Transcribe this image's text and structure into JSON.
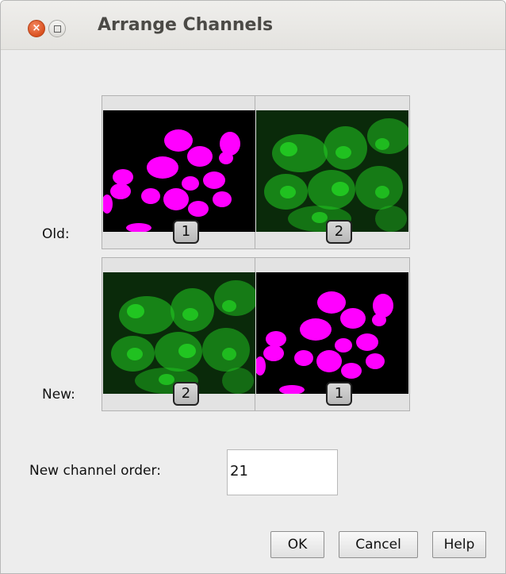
{
  "window": {
    "title": "Arrange Channels",
    "close_glyph": "×"
  },
  "rows": {
    "old_label": "Old:",
    "new_label": "New:"
  },
  "old_channels": [
    {
      "badge": "1",
      "color": "#ff00ff",
      "kind": "nuclei"
    },
    {
      "badge": "2",
      "color": "#22cc22",
      "kind": "cells"
    }
  ],
  "new_channels": [
    {
      "badge": "2",
      "color": "#22cc22",
      "kind": "cells"
    },
    {
      "badge": "1",
      "color": "#ff00ff",
      "kind": "nuclei"
    }
  ],
  "form": {
    "order_label": "New channel order:",
    "order_value": "21"
  },
  "buttons": {
    "ok": "OK",
    "cancel": "Cancel",
    "help": "Help"
  },
  "icons": {
    "close": "close-icon",
    "maximize": "maximize-icon"
  }
}
